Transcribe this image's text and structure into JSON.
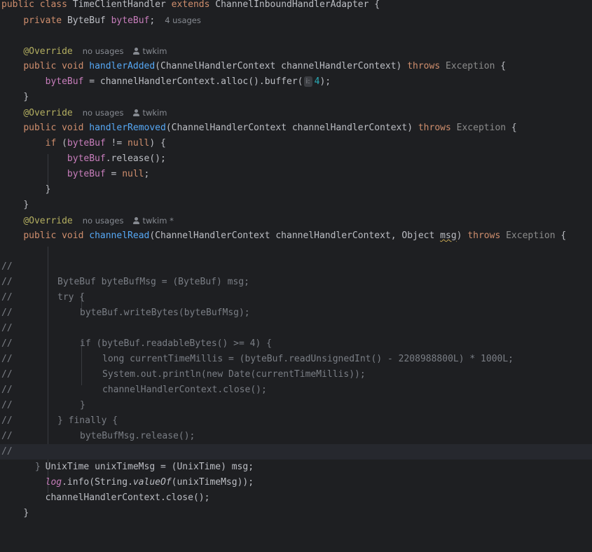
{
  "editor": {
    "class_decl": {
      "public": "public",
      "class": "class",
      "name": "TimeClientHandler",
      "extends": "extends",
      "parent": "ChannelInboundHandlerAdapter",
      "brace": " {"
    },
    "field_decl": {
      "private": "private",
      "type": "ByteBuf",
      "name": "byteBuf",
      "semi": ";",
      "usages": "4 usages"
    },
    "override_1": {
      "annotation": "@Override",
      "usages": "no usages",
      "author": "twkim"
    },
    "handler_added": {
      "public": "public",
      "void": "void",
      "name": "handlerAdded",
      "params": "(ChannelHandlerContext channelHandlerContext)",
      "throws": "throws",
      "exception": "Exception",
      "brace": " {"
    },
    "alloc_stmt": {
      "field": "byteBuf",
      "middle": " = channelHandlerContext.alloc().buffer(",
      "param_hint": "i:",
      "arg": "4",
      "end": ");"
    },
    "close_brace": "}",
    "override_2": {
      "annotation": "@Override",
      "usages": "no usages",
      "author": "twkim"
    },
    "handler_removed": {
      "public": "public",
      "void": "void",
      "name": "handlerRemoved",
      "params": "(ChannelHandlerContext channelHandlerContext)",
      "throws": "throws",
      "exception": "Exception",
      "brace": " {"
    },
    "if_stmt": {
      "if": "if",
      "open": " (",
      "field": "byteBuf",
      "op": " != ",
      "null": "null",
      "close": ") {"
    },
    "release_stmt": {
      "field": "byteBuf",
      "rest": ".release();"
    },
    "null_stmt": {
      "field": "byteBuf",
      "eq": " = ",
      "null": "null",
      "semi": ";"
    },
    "override_3": {
      "annotation": "@Override",
      "usages": "no usages",
      "author": "twkim *"
    },
    "channel_read": {
      "public": "public",
      "void": "void",
      "name": "channelRead",
      "params_1": "(ChannelHandlerContext channelHandlerContext, Object ",
      "msg": "msg",
      "params_2": ")",
      "throws": "throws",
      "exception": "Exception",
      "brace": " {"
    },
    "comment_marker": "//",
    "commented_lines": [
      "ByteBuf byteBufMsg = (ByteBuf) msg;",
      "try {",
      "byteBuf.writeBytes(byteBufMsg);",
      "",
      "if (byteBuf.readableBytes() >= 4) {",
      "long currentTimeMillis = (byteBuf.readUnsignedInt() - 2208988800L) * 1000L;",
      "System.out.println(new Date(currentTimeMillis));",
      "channelHandlerContext.close();",
      "}",
      "} finally {",
      "byteBufMsg.release();",
      "}",
      "}"
    ],
    "unix_stmt": "UnixTime unixTimeMsg = (UnixTime) msg;",
    "log_stmt": {
      "log": "log",
      "mid": ".info(String.",
      "value_of": "valueOf",
      "end": "(unixTimeMsg));"
    },
    "close_stmt": "channelHandlerContext.close();"
  }
}
